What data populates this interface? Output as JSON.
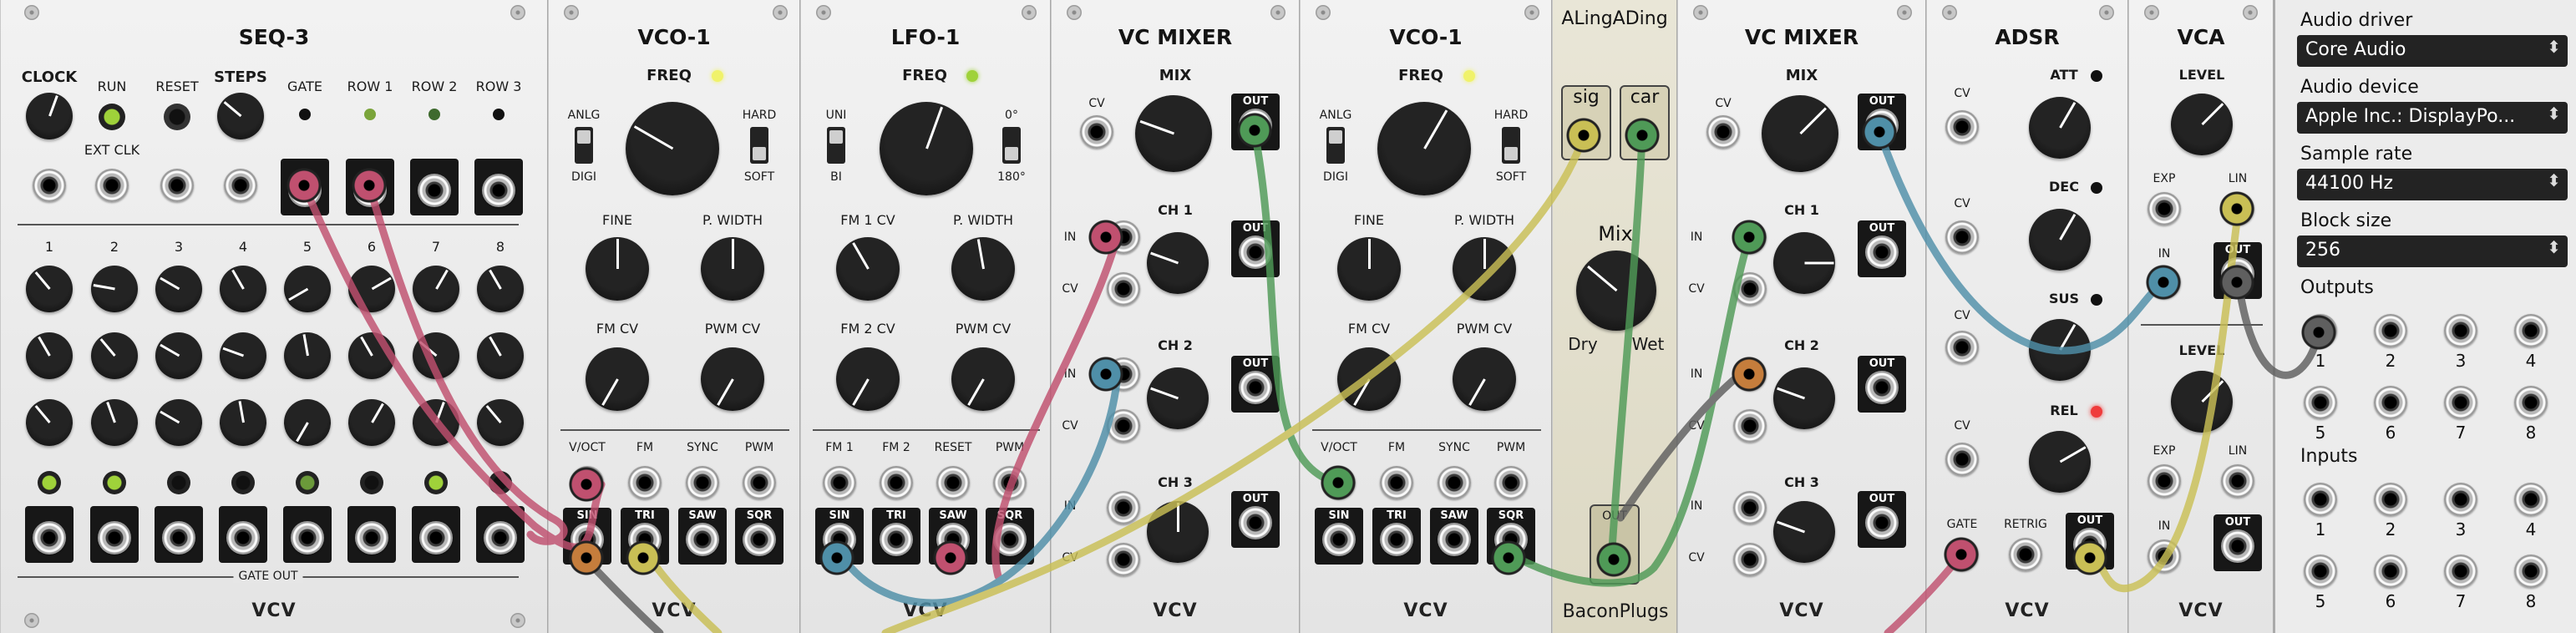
{
  "modules": {
    "seq3": {
      "title": "SEQ-3",
      "clock": "CLOCK",
      "run": "RUN",
      "reset": "RESET",
      "steps": "STEPS",
      "ext_clk": "EXT CLK",
      "gate": "GATE",
      "row1": "ROW 1",
      "row2": "ROW 2",
      "row3": "ROW 3",
      "step_numbers": [
        "1",
        "2",
        "3",
        "4",
        "5",
        "6",
        "7",
        "8"
      ],
      "gate_out": "GATE OUT",
      "logo": "VCV"
    },
    "vco1a": {
      "title": "VCO-1",
      "freq": "FREQ",
      "anlg": "ANLG",
      "digi": "DIGI",
      "hard": "HARD",
      "soft": "SOFT",
      "fine": "FINE",
      "pwidth": "P. WIDTH",
      "fmcv": "FM CV",
      "pwmcv": "PWM CV",
      "voct": "V/OCT",
      "fm": "FM",
      "sync": "SYNC",
      "pwm": "PWM",
      "sin": "SIN",
      "tri": "TRI",
      "saw": "SAW",
      "sqr": "SQR",
      "logo": "VCV"
    },
    "lfo1": {
      "title": "LFO-1",
      "freq": "FREQ",
      "uni": "UNI",
      "bi": "BI",
      "deg0": "0°",
      "deg180": "180°",
      "fm1cv": "FM 1 CV",
      "pwidth": "P. WIDTH",
      "fm2cv": "FM 2 CV",
      "pwmcv": "PWM CV",
      "fm1": "FM 1",
      "fm2": "FM 2",
      "reset": "RESET",
      "pwm": "PWM",
      "sin": "SIN",
      "tri": "TRI",
      "saw": "SAW",
      "sqr": "SQR",
      "logo": "VCV"
    },
    "mixer1": {
      "title": "VC MIXER",
      "mix": "MIX",
      "cv": "CV",
      "out": "OUT",
      "ch1": "CH 1",
      "ch2": "CH 2",
      "ch3": "CH 3",
      "in": "IN",
      "logo": "VCV"
    },
    "vco1b": {
      "title": "VCO-1",
      "freq": "FREQ",
      "anlg": "ANLG",
      "digi": "DIGI",
      "hard": "HARD",
      "soft": "SOFT",
      "fine": "FINE",
      "pwidth": "P. WIDTH",
      "fmcv": "FM CV",
      "pwmcv": "PWM CV",
      "voct": "V/OCT",
      "fm": "FM",
      "sync": "SYNC",
      "pwm": "PWM",
      "sin": "SIN",
      "tri": "TRI",
      "saw": "SAW",
      "sqr": "SQR",
      "logo": "VCV"
    },
    "alinga": {
      "title": "ALingADing",
      "sig": "sig",
      "car": "car",
      "mix": "Mix",
      "dry": "Dry",
      "wet": "Wet",
      "out": "OUT",
      "brand": "BaconPlugs"
    },
    "mixer2": {
      "title": "VC MIXER",
      "mix": "MIX",
      "cv": "CV",
      "out": "OUT",
      "ch1": "CH 1",
      "ch2": "CH 2",
      "ch3": "CH 3",
      "in": "IN",
      "logo": "VCV"
    },
    "adsr": {
      "title": "ADSR",
      "cv": "CV",
      "att": "ATT",
      "dec": "DEC",
      "sus": "SUS",
      "rel": "REL",
      "gate": "GATE",
      "retrig": "RETRIG",
      "out": "OUT",
      "logo": "VCV"
    },
    "vca": {
      "title": "VCA",
      "level": "LEVEL",
      "exp": "EXP",
      "lin": "LIN",
      "in": "IN",
      "out": "OUT",
      "logo": "VCV"
    }
  },
  "audio_interface": {
    "driver_label": "Audio driver",
    "driver_value": "Core Audio",
    "device_label": "Audio device",
    "device_value": "Apple Inc.: DisplayPo...",
    "rate_label": "Sample rate",
    "rate_value": "44100 Hz",
    "block_label": "Block size",
    "block_value": "256",
    "outputs_label": "Outputs",
    "inputs_label": "Inputs",
    "outputs": [
      "1",
      "2",
      "3",
      "4",
      "5",
      "6",
      "7",
      "8"
    ],
    "inputs": [
      "1",
      "2",
      "3",
      "4",
      "5",
      "6",
      "7",
      "8"
    ]
  },
  "colors": {
    "cable_red": "#c0506f",
    "cable_green": "#4f9a57",
    "cable_blue": "#4f8fa8",
    "cable_yellow": "#c9bf55",
    "cable_gray": "#5f5f5f",
    "led_green": "#9fd23a",
    "led_yellow": "#f0f26a",
    "led_red": "#ef3b3b"
  }
}
